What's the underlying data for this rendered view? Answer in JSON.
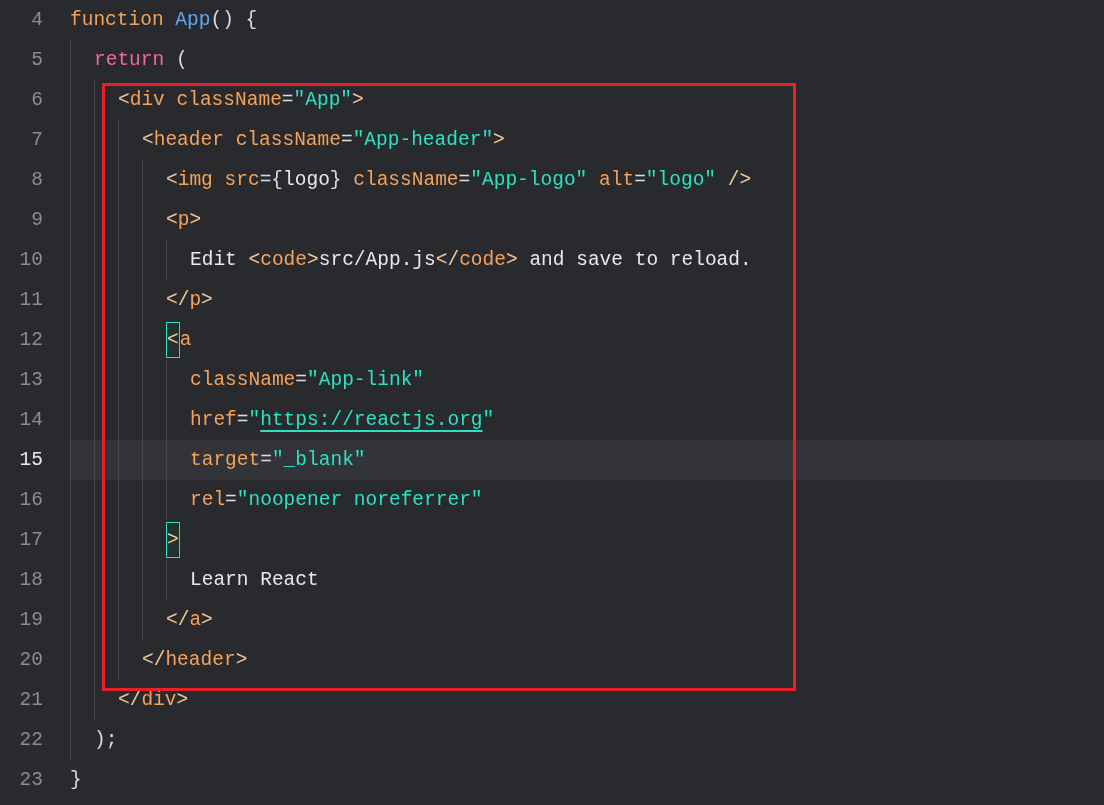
{
  "editor": {
    "lines": [
      {
        "number": "4",
        "current": false,
        "boxed": false,
        "tokens": [
          {
            "kind": "keyword",
            "text": "function "
          },
          {
            "kind": "function",
            "text": "App"
          },
          {
            "kind": "punct",
            "text": "() {"
          }
        ],
        "children": [
          {
            "number": "5",
            "current": false,
            "boxed": false,
            "tokens": [
              {
                "kind": "control",
                "text": "return "
              },
              {
                "kind": "punct",
                "text": "("
              }
            ],
            "children": [
              {
                "number": "6",
                "current": false,
                "boxed": true,
                "tokens": [
                  {
                    "kind": "bracket",
                    "text": "<"
                  },
                  {
                    "kind": "tag",
                    "text": "div "
                  },
                  {
                    "kind": "attr",
                    "text": "className"
                  },
                  {
                    "kind": "punct",
                    "text": "="
                  },
                  {
                    "kind": "string",
                    "text": "\"App\""
                  },
                  {
                    "kind": "bracket",
                    "text": ">"
                  }
                ],
                "children": [
                  {
                    "number": "7",
                    "current": false,
                    "boxed": false,
                    "tokens": [
                      {
                        "kind": "bracket",
                        "text": "<"
                      },
                      {
                        "kind": "tag",
                        "text": "header "
                      },
                      {
                        "kind": "attr",
                        "text": "className"
                      },
                      {
                        "kind": "punct",
                        "text": "="
                      },
                      {
                        "kind": "string",
                        "text": "\"App-header\""
                      },
                      {
                        "kind": "bracket",
                        "text": ">"
                      }
                    ],
                    "children": [
                      {
                        "number": "8",
                        "current": false,
                        "boxed": false,
                        "tokens": [
                          {
                            "kind": "bracket",
                            "text": "<"
                          },
                          {
                            "kind": "tag",
                            "text": "img "
                          },
                          {
                            "kind": "attr",
                            "text": "src"
                          },
                          {
                            "kind": "punct",
                            "text": "={"
                          },
                          {
                            "kind": "text",
                            "text": "logo"
                          },
                          {
                            "kind": "punct",
                            "text": "} "
                          },
                          {
                            "kind": "attr",
                            "text": "className"
                          },
                          {
                            "kind": "punct",
                            "text": "="
                          },
                          {
                            "kind": "string",
                            "text": "\"App-logo\" "
                          },
                          {
                            "kind": "attr",
                            "text": "alt"
                          },
                          {
                            "kind": "punct",
                            "text": "="
                          },
                          {
                            "kind": "string",
                            "text": "\"logo\" "
                          },
                          {
                            "kind": "bracket",
                            "text": "/>"
                          }
                        ]
                      },
                      {
                        "number": "9",
                        "current": false,
                        "boxed": false,
                        "tokens": [
                          {
                            "kind": "bracket",
                            "text": "<"
                          },
                          {
                            "kind": "tag",
                            "text": "p"
                          },
                          {
                            "kind": "bracket",
                            "text": ">"
                          }
                        ],
                        "children": [
                          {
                            "number": "10",
                            "current": false,
                            "boxed": false,
                            "tokens": [
                              {
                                "kind": "text",
                                "text": "Edit "
                              },
                              {
                                "kind": "bracket",
                                "text": "<"
                              },
                              {
                                "kind": "tag",
                                "text": "code"
                              },
                              {
                                "kind": "bracket",
                                "text": ">"
                              },
                              {
                                "kind": "text",
                                "text": "src/App.js"
                              },
                              {
                                "kind": "bracket",
                                "text": "</"
                              },
                              {
                                "kind": "tag",
                                "text": "code"
                              },
                              {
                                "kind": "bracket",
                                "text": ">"
                              },
                              {
                                "kind": "text",
                                "text": " and save to reload."
                              }
                            ]
                          }
                        ]
                      },
                      {
                        "number": "11",
                        "current": false,
                        "boxed": false,
                        "tokens": [
                          {
                            "kind": "bracket",
                            "text": "</"
                          },
                          {
                            "kind": "tag",
                            "text": "p"
                          },
                          {
                            "kind": "bracket",
                            "text": ">"
                          }
                        ]
                      },
                      {
                        "number": "12",
                        "current": false,
                        "boxed": false,
                        "tokens": [
                          {
                            "kind": "match",
                            "text": "<"
                          },
                          {
                            "kind": "tag",
                            "text": "a"
                          }
                        ],
                        "children": [
                          {
                            "number": "13",
                            "current": false,
                            "boxed": false,
                            "tokens": [
                              {
                                "kind": "attr",
                                "text": "className"
                              },
                              {
                                "kind": "punct",
                                "text": "="
                              },
                              {
                                "kind": "string",
                                "text": "\"App-link\""
                              }
                            ]
                          },
                          {
                            "number": "14",
                            "current": false,
                            "boxed": false,
                            "tokens": [
                              {
                                "kind": "attr",
                                "text": "href"
                              },
                              {
                                "kind": "punct",
                                "text": "="
                              },
                              {
                                "kind": "string",
                                "text": "\""
                              },
                              {
                                "kind": "link",
                                "text": "https://reactjs.org"
                              },
                              {
                                "kind": "string",
                                "text": "\""
                              }
                            ]
                          },
                          {
                            "number": "15",
                            "current": true,
                            "boxed": false,
                            "tokens": [
                              {
                                "kind": "attr",
                                "text": "target"
                              },
                              {
                                "kind": "punct",
                                "text": "="
                              },
                              {
                                "kind": "string",
                                "text": "\"_blank\""
                              }
                            ]
                          },
                          {
                            "number": "16",
                            "current": false,
                            "boxed": false,
                            "tokens": [
                              {
                                "kind": "attr",
                                "text": "rel"
                              },
                              {
                                "kind": "punct",
                                "text": "="
                              },
                              {
                                "kind": "string",
                                "text": "\"noopener noreferrer\""
                              }
                            ]
                          }
                        ]
                      },
                      {
                        "number": "17",
                        "current": false,
                        "boxed": false,
                        "tokens": [
                          {
                            "kind": "match",
                            "text": ">"
                          }
                        ],
                        "children": [
                          {
                            "number": "18",
                            "current": false,
                            "boxed": false,
                            "tokens": [
                              {
                                "kind": "text",
                                "text": "Learn React"
                              }
                            ]
                          }
                        ]
                      },
                      {
                        "number": "19",
                        "current": false,
                        "boxed": false,
                        "tokens": [
                          {
                            "kind": "bracket",
                            "text": "</"
                          },
                          {
                            "kind": "tag",
                            "text": "a"
                          },
                          {
                            "kind": "bracket",
                            "text": ">"
                          }
                        ]
                      }
                    ]
                  },
                  {
                    "number": "20",
                    "current": false,
                    "boxed": false,
                    "tokens": [
                      {
                        "kind": "bracket",
                        "text": "</"
                      },
                      {
                        "kind": "tag",
                        "text": "header"
                      },
                      {
                        "kind": "bracket",
                        "text": ">"
                      }
                    ]
                  }
                ]
              },
              {
                "number": "21",
                "current": false,
                "boxed": false,
                "tokens": [
                  {
                    "kind": "bracket",
                    "text": "</"
                  },
                  {
                    "kind": "tag",
                    "text": "div"
                  },
                  {
                    "kind": "bracket",
                    "text": ">"
                  }
                ]
              }
            ]
          },
          {
            "number": "22",
            "current": false,
            "boxed": false,
            "tokens": [
              {
                "kind": "punct",
                "text": ");"
              }
            ]
          }
        ]
      },
      {
        "number": "23",
        "current": false,
        "boxed": false,
        "tokens": [
          {
            "kind": "punct",
            "text": "}"
          }
        ]
      }
    ]
  }
}
